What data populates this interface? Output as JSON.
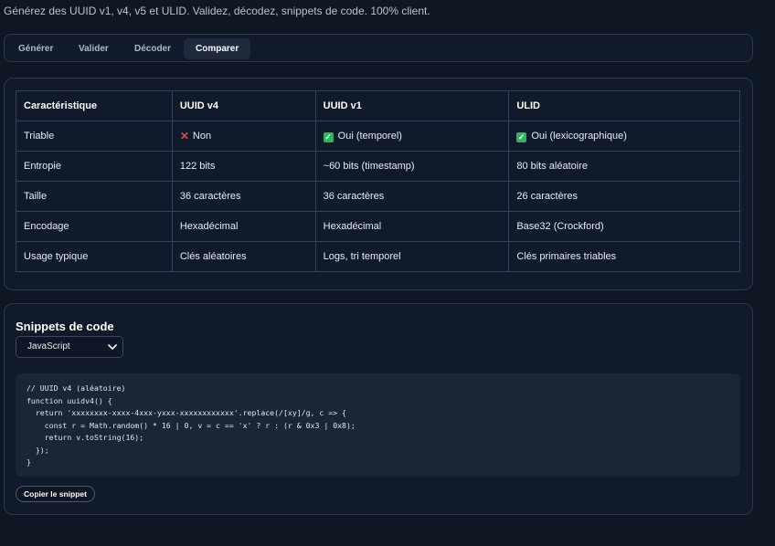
{
  "subtitle": "Générez des UUID v1, v4, v5 et ULID. Validez, décodez, snippets de code. 100% client.",
  "tabs": [
    {
      "label": "Générer"
    },
    {
      "label": "Valider"
    },
    {
      "label": "Décoder"
    },
    {
      "label": "Comparer"
    }
  ],
  "table": {
    "headers": [
      "Caractéristique",
      "UUID v4",
      "UUID v1",
      "ULID"
    ],
    "rows": [
      {
        "feature": "Triable",
        "v4": "Non",
        "v1": "Oui (temporel)",
        "ulid": "Oui (lexicographique)"
      },
      {
        "feature": "Entropie",
        "v4": "122 bits",
        "v1": "~60 bits (timestamp)",
        "ulid": "80 bits aléatoire"
      },
      {
        "feature": "Taille",
        "v4": "36 caractères",
        "v1": "36 caractères",
        "ulid": "26 caractères"
      },
      {
        "feature": "Encodage",
        "v4": "Hexadécimal",
        "v1": "Hexadécimal",
        "ulid": "Base32 (Crockford)"
      },
      {
        "feature": "Usage typique",
        "v4": "Clés aléatoires",
        "v1": "Logs, tri temporel",
        "ulid": "Clés primaires triables"
      }
    ]
  },
  "snippets": {
    "title": "Snippets de code",
    "language": "JavaScript",
    "code": "// UUID v4 (aléatoire)\nfunction uuidv4() {\n  return 'xxxxxxxx-xxxx-4xxx-yxxx-xxxxxxxxxxxx'.replace(/[xy]/g, c => {\n    const r = Math.random() * 16 | 0, v = c == 'x' ? r : (r & 0x3 | 0x8);\n    return v.toString(16);\n  });\n}",
    "copy_label": "Copier le snippet"
  },
  "colors": {
    "background": "#0f1725",
    "card": "#111a2a",
    "border": "#2c394d",
    "no_icon": "#e54848",
    "yes_icon": "#2fb55a"
  }
}
